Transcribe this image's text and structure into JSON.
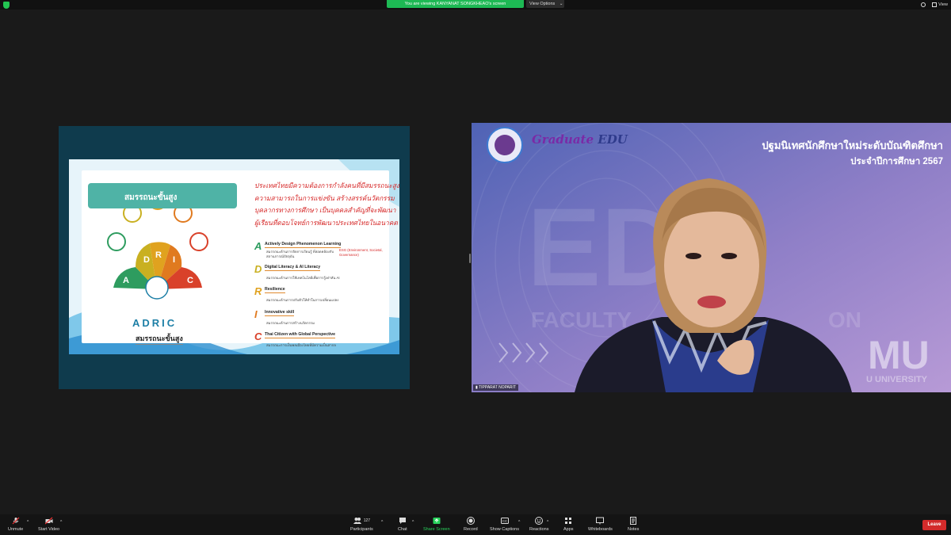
{
  "topbar": {
    "share_banner": "You are viewing KANYANAT SONGKHEAO's screen",
    "view_options": "View Options",
    "view_label": "View"
  },
  "slide": {
    "banner_title": "สมรรถนะขั้นสูง",
    "thai_paragraph": [
      "ประเทศไทยมีความต้องการกำลังคนที่มีสมรรถนะสูง มี",
      "ความสามารถในการแข่งขัน สร้างสรรค์นวัตกรรม",
      "บุคลากรทางการศึกษา เป็นบุคคลสำคัญที่จะพัฒนา",
      "ผู้เรียนที่ตอบโจทย์การพัฒนาประเทศไทยในอนาคต"
    ],
    "items": [
      {
        "letter": "A",
        "color": "#2e9c5f",
        "title": "Actively Design Phenomenon Learning",
        "sub": "สมรรถนะด้านการจัดการเรียนรู้ ที่สอดคล้องกับสถานการณ์ปัจจุบัน",
        "extra": "ESG (Environment, Societal, Governance)"
      },
      {
        "letter": "D",
        "color": "#c9b021",
        "title": "Digital Literacy & AI Literacy",
        "sub": "สมรรถนะด้านการใช้เทคโนโลยีเพื่อการรู้เท่าทัน AI",
        "extra": ""
      },
      {
        "letter": "R",
        "color": "#e0a21f",
        "title": "Resilience",
        "sub": "สมรรถนะด้านการปรับตัวให้ทำในการเปลี่ยนแปลง",
        "extra": ""
      },
      {
        "letter": "I",
        "color": "#e07a1f",
        "title": "Innovative skill",
        "sub": "สมรรถนะด้านการสร้างนวัตกรรม",
        "extra": ""
      },
      {
        "letter": "C",
        "color": "#d9412a",
        "title": "Thai Citizen with Global Perspective",
        "sub": "สมรรถนะการเป็นพลเมืองไทยที่มีความเป็นสากล",
        "extra": ""
      }
    ],
    "logo_text": "ADRIC",
    "logo_caption": "สมรรถนะขั้นสูง",
    "wheel_letters": [
      "A",
      "D",
      "R",
      "I",
      "C"
    ]
  },
  "video": {
    "title_line1": "ปฐมนิเทศนักศึกษาใหม่ระดับบัณฑิตศึกษา",
    "title_line2": "ประจำปีการศึกษา 2567",
    "logo_text": "Graduate",
    "logo_edu": "EDU",
    "participant_name": "TIPPARAT NOPARIT",
    "bg_big_text": "EDU",
    "bg_mid_text": "FACULTY",
    "bg_mid_text2": "ON",
    "bg_univ": "MU",
    "bg_univ2": "U UNIVERSITY"
  },
  "toolbar": {
    "unmute": "Unmute",
    "start_video": "Start Video",
    "participants": "Participants",
    "participants_count": "127",
    "chat": "Chat",
    "share_screen": "Share Screen",
    "record": "Record",
    "show_captions": "Show Captions",
    "reactions": "Reactions",
    "apps": "Apps",
    "whiteboards": "Whiteboards",
    "notes": "Notes",
    "leave": "Leave"
  }
}
